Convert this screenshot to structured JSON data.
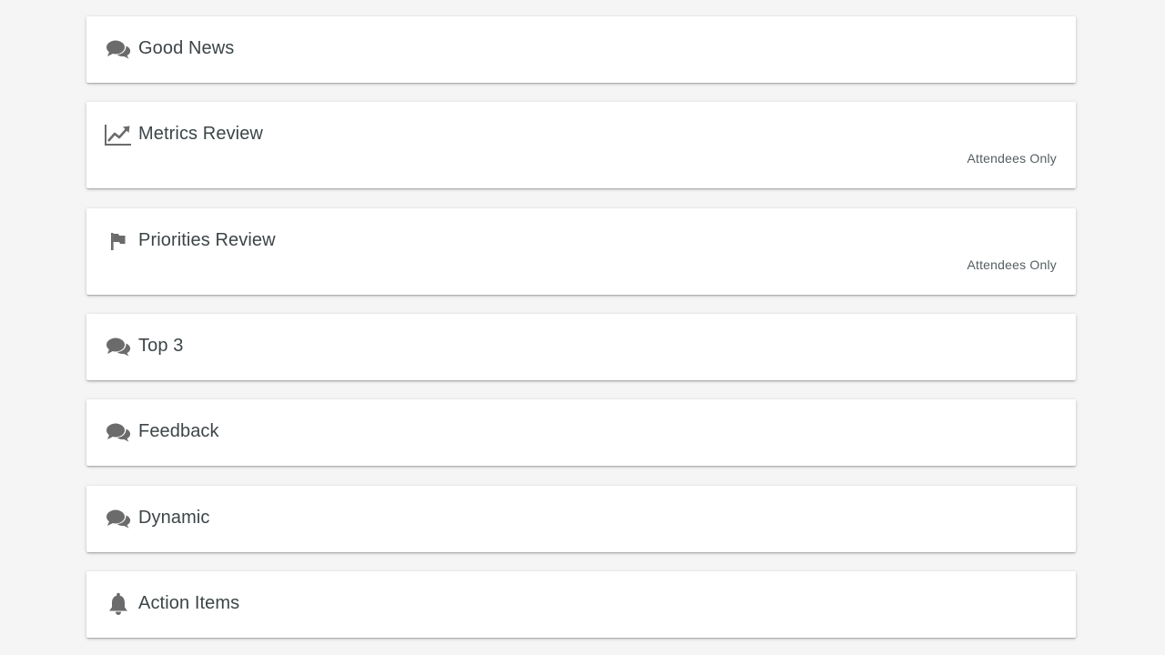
{
  "colors": {
    "background": "#f5f5f5",
    "card": "#ffffff",
    "title_text": "#3d4548",
    "icon": "#6b6b6b"
  },
  "agenda": [
    {
      "title": "Good News",
      "icon": "comments-icon",
      "tag": ""
    },
    {
      "title": "Metrics Review",
      "icon": "line-chart-icon",
      "tag": "Attendees Only"
    },
    {
      "title": "Priorities Review",
      "icon": "flag-icon",
      "tag": "Attendees Only"
    },
    {
      "title": "Top 3",
      "icon": "comments-icon",
      "tag": ""
    },
    {
      "title": "Feedback",
      "icon": "comments-icon",
      "tag": ""
    },
    {
      "title": "Dynamic",
      "icon": "comments-icon",
      "tag": ""
    },
    {
      "title": "Action Items",
      "icon": "bell-icon",
      "tag": ""
    }
  ]
}
